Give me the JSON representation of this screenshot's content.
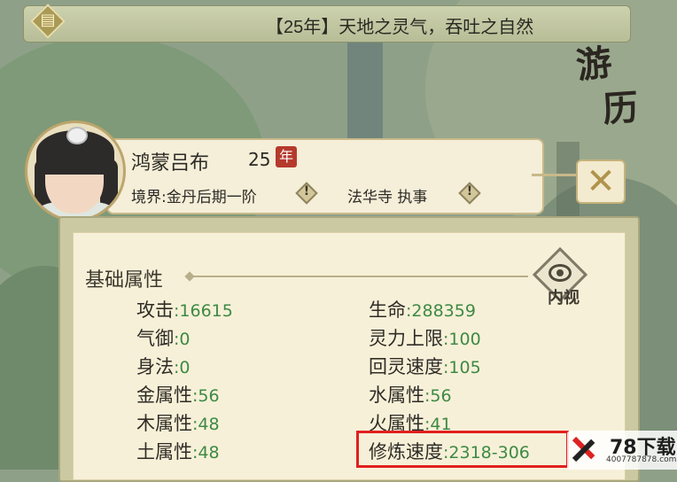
{
  "topbar": {
    "rank_icon": "rank-emblem-icon",
    "message": "【25年】天地之灵气，吞吐之自然"
  },
  "background": {
    "youli_title": [
      "游",
      "历"
    ]
  },
  "character": {
    "name": "鸿蒙吕布",
    "age": "25",
    "age_unit": "年",
    "realm": "境界:金丹后期一阶",
    "sect": "法华寺 执事",
    "info_glyph": "!"
  },
  "close_icon_glyph": "✕",
  "attributes": {
    "section_title": "基础属性",
    "inspect_label": "内视",
    "left": [
      {
        "label": "攻击",
        "value": ":16615"
      },
      {
        "label": "气御",
        "value": ":0"
      },
      {
        "label": "身法",
        "value": ":0"
      },
      {
        "label": "金属性",
        "value": ":56"
      },
      {
        "label": "木属性",
        "value": ":48"
      },
      {
        "label": "土属性",
        "value": ":48"
      }
    ],
    "right": [
      {
        "label": "生命",
        "value": ":288359"
      },
      {
        "label": "灵力上限",
        "value": ":100"
      },
      {
        "label": "回灵速度",
        "value": ":105"
      },
      {
        "label": "水属性",
        "value": ":56"
      },
      {
        "label": "火属性",
        "value": ":41"
      },
      {
        "label": "修炼速度",
        "value": ":2318-306"
      }
    ]
  },
  "watermark": {
    "title": "78下载",
    "url": "4007787878.com"
  },
  "colors": {
    "value_green": "#3d8a44",
    "highlight_red": "#e1201f",
    "age_badge": "#b53a2c"
  }
}
